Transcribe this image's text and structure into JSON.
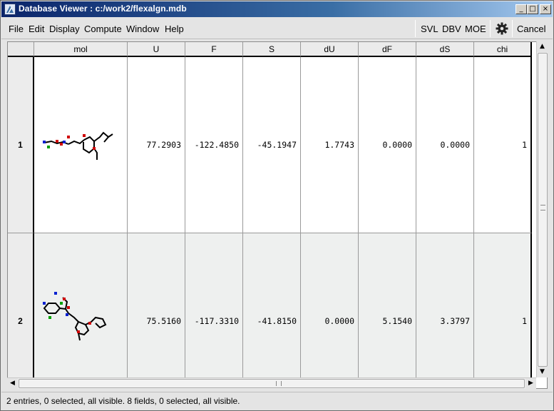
{
  "window": {
    "title": "Database Viewer : c:/work2/flexalgn.mdb",
    "controls": {
      "minimize": "_",
      "maximize": "□",
      "close": "×"
    }
  },
  "menu": {
    "items": [
      {
        "label": "File"
      },
      {
        "label": "Edit"
      },
      {
        "label": "Display"
      },
      {
        "label": "Compute"
      },
      {
        "label": "Window"
      },
      {
        "label": "Help"
      }
    ],
    "tools": {
      "svl": "SVL",
      "dbv": "DBV",
      "moe": "MOE",
      "settings_icon": "gear-icon",
      "cancel": "Cancel"
    }
  },
  "table": {
    "columns": [
      "mol",
      "U",
      "F",
      "S",
      "dU",
      "dF",
      "dS",
      "chi"
    ],
    "rows": [
      {
        "index": "1",
        "U": "77.2903",
        "F": "-122.4850",
        "S": "-45.1947",
        "dU": "1.7743",
        "dF": "0.0000",
        "dS": "0.0000",
        "chi": "1"
      },
      {
        "index": "2",
        "U": "75.5160",
        "F": "-117.3310",
        "S": "-41.8150",
        "dU": "0.0000",
        "dF": "5.1540",
        "dS": "3.3797",
        "chi": "1"
      }
    ]
  },
  "scrollbar": {
    "up": "▲",
    "down": "▼",
    "left": "◀",
    "right": "▶"
  },
  "status": {
    "text": "2 entries, 0 selected, all visible. 8 fields, 0 selected, all visible."
  }
}
